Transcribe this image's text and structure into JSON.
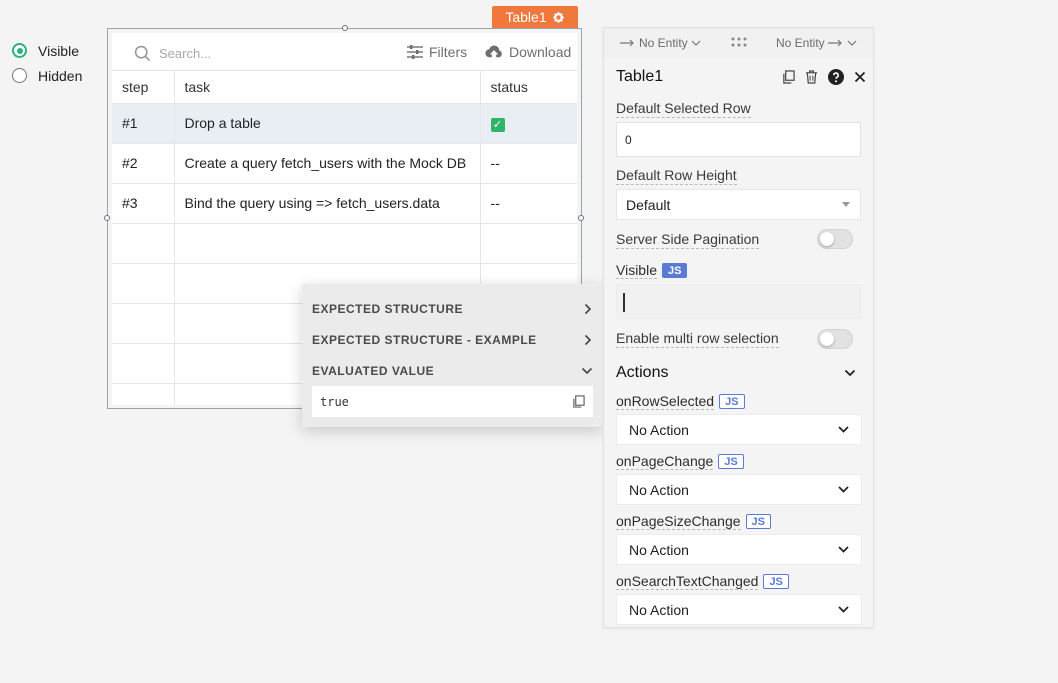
{
  "radio_group": {
    "options": [
      {
        "label": "Visible",
        "checked": true
      },
      {
        "label": "Hidden",
        "checked": false
      }
    ],
    "accent_color": "#29b37b"
  },
  "table_widget": {
    "tag_label": "Table1",
    "search_placeholder": "Search...",
    "filters_label": "Filters",
    "download_label": "Download",
    "columns": [
      "step",
      "task",
      "status"
    ],
    "rows": [
      {
        "step": "#1",
        "task": "Drop a table",
        "status": "✅",
        "status_icon": "check-icon",
        "selected": true
      },
      {
        "step": "#2",
        "task": "Create a query fetch_users with the Mock DB",
        "status": "--",
        "selected": false
      },
      {
        "step": "#3",
        "task": "Bind the query using => fetch_users.data",
        "status": "--",
        "selected": false
      }
    ],
    "tag_color": "#f0783d"
  },
  "eval_popup": {
    "sections": [
      {
        "label": "EXPECTED STRUCTURE",
        "icon": "chevron-right-icon"
      },
      {
        "label": "EXPECTED STRUCTURE - EXAMPLE",
        "icon": "chevron-right-icon"
      },
      {
        "label": "EVALUATED VALUE",
        "icon": "chevron-down-icon"
      }
    ],
    "evaluated_value": "true"
  },
  "property_pane": {
    "entity_left": "No Entity",
    "entity_right": "No Entity",
    "title": "Table1",
    "default_selected_row_label": "Default Selected Row",
    "default_selected_row_value": "0",
    "default_row_height_label": "Default Row Height",
    "default_row_height_value": "Default",
    "server_side_pagination_label": "Server Side Pagination",
    "visible_label": "Visible",
    "js_badge": "JS",
    "multi_row_label": "Enable multi row selection",
    "actions_title": "Actions",
    "actions": [
      {
        "label": "onRowSelected",
        "value": "No Action"
      },
      {
        "label": "onPageChange",
        "value": "No Action"
      },
      {
        "label": "onPageSizeChange",
        "value": "No Action"
      },
      {
        "label": "onSearchTextChanged",
        "value": "No Action"
      }
    ],
    "js_badge_color": "#5b7ad1"
  }
}
